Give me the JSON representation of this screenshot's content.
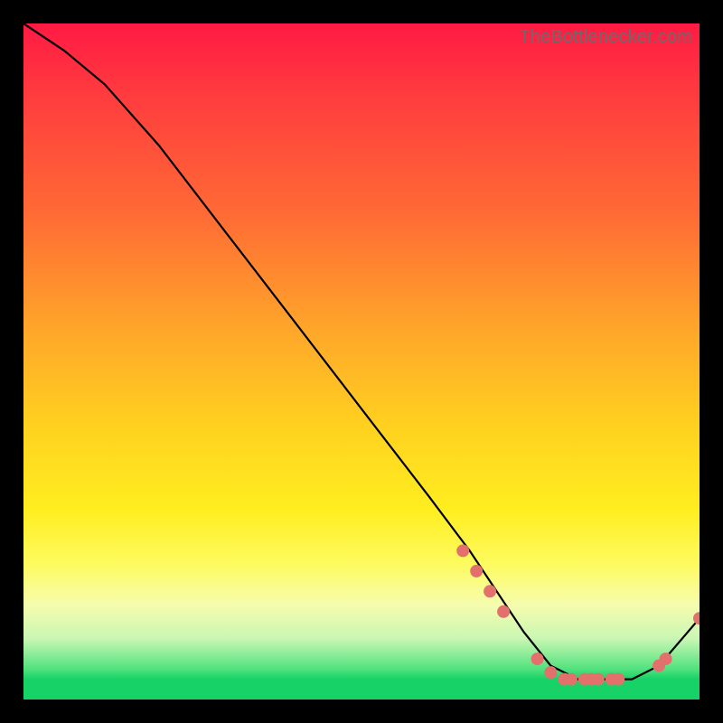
{
  "watermark": "TheBottlenecker.com",
  "chart_data": {
    "type": "line",
    "title": "",
    "xlabel": "",
    "ylabel": "",
    "xlim": [
      0,
      100
    ],
    "ylim": [
      0,
      100
    ],
    "series": [
      {
        "name": "curve",
        "x": [
          0,
          6,
          12,
          20,
          30,
          40,
          50,
          60,
          66,
          70,
          74,
          78,
          82,
          86,
          90,
          94,
          100
        ],
        "y": [
          100,
          96,
          91,
          82,
          69,
          56,
          43,
          30,
          22,
          16,
          10,
          5,
          3,
          3,
          3,
          5,
          12
        ]
      }
    ],
    "markers": {
      "x": [
        65,
        67,
        69,
        71,
        76,
        78,
        80,
        81,
        83,
        84,
        85,
        87,
        88,
        94,
        95,
        100
      ],
      "y": [
        22,
        19,
        16,
        13,
        6,
        4,
        3,
        3,
        3,
        3,
        3,
        3,
        3,
        5,
        6,
        12
      ]
    },
    "colors": {
      "line": "#000000",
      "marker": "#e2716d"
    }
  }
}
